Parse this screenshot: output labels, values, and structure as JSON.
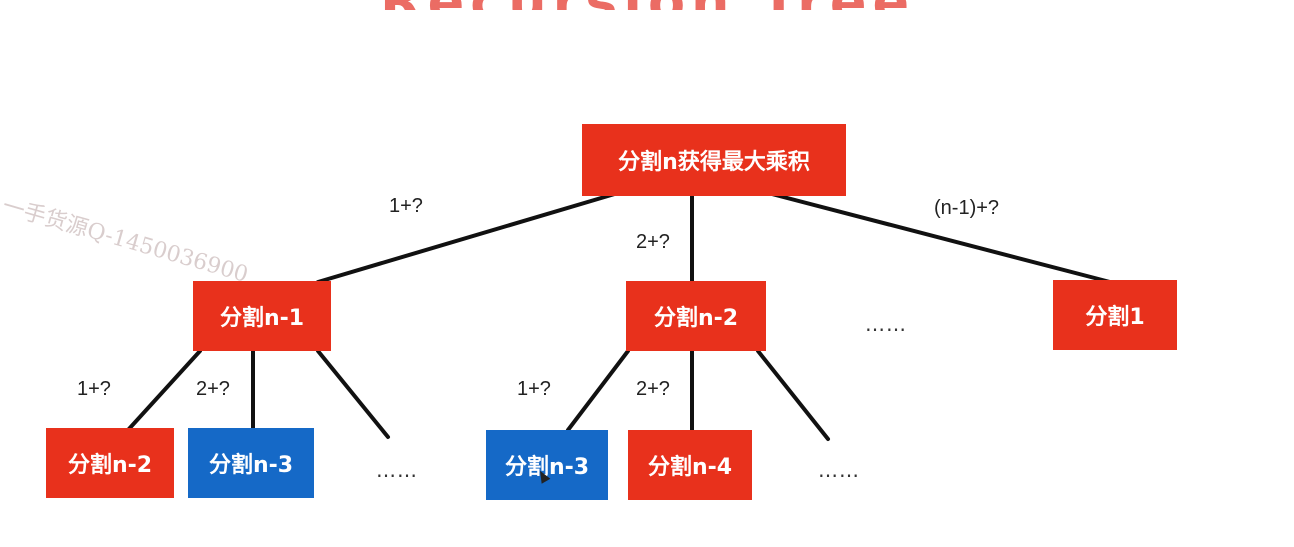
{
  "title_fragment": "Recursion Tree",
  "watermark": "一手货源Q-1450036900",
  "colors": {
    "node_red": "#e8311c",
    "node_blue": "#1569c7",
    "edge": "#111111",
    "label": "#222222"
  },
  "nodes": {
    "root": "分割n获得最大乘积",
    "n1": "分割n-1",
    "n2": "分割n-2",
    "one": "分割1",
    "a_n2": "分割n-2",
    "a_n3": "分割n-3",
    "b_n3": "分割n-3",
    "b_n4": "分割n-4"
  },
  "edge_labels": {
    "root_1": "1+?",
    "root_2": "2+?",
    "root_n1": "(n-1)+?",
    "n1_1": "1+?",
    "n1_2": "2+?",
    "n2_1": "1+?",
    "n2_2": "2+?"
  },
  "ellipses": {
    "level1": "……",
    "n1_more": "……",
    "n2_more": "……"
  }
}
